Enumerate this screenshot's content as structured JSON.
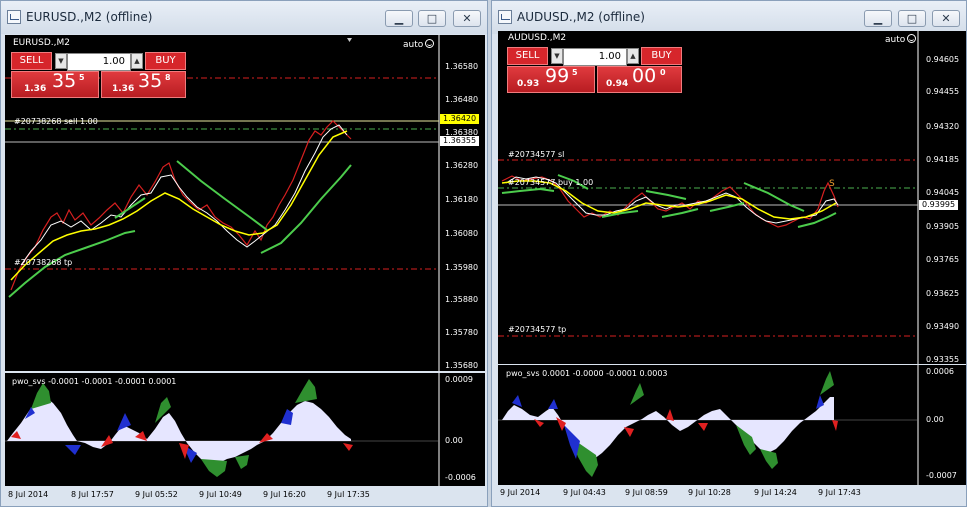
{
  "colors": {
    "ask_box": "#ffff00",
    "bid_box": "#ffffff",
    "line_red": "#d62020",
    "sl_label": "#f0a030"
  },
  "windows": [
    {
      "title": "EURUSD.,M2 (offline)",
      "symbol_label": "EURUSD.,M2",
      "auto_label": "auto",
      "panel": {
        "sell": "SELL",
        "buy": "BUY",
        "lot": "1.00",
        "sell_price": {
          "small": "1.36",
          "big": "35",
          "sup": "5"
        },
        "buy_price": {
          "small": "1.36",
          "big": "35",
          "sup": "8"
        }
      },
      "price_axis": [
        "1.36580",
        "1.36480",
        "1.36380",
        "1.36280",
        "1.36180",
        "1.36080",
        "1.35980",
        "1.35880",
        "1.35780",
        "1.35680"
      ],
      "ask_price": "1.36420",
      "bid_price": "1.36355",
      "order_labels": [
        "#20738268 sell 1.00",
        "#20738268 tp"
      ],
      "indicator_label": "pwo_svs -0.0001 -0.0001 -0.0001 0.0001",
      "indicator_axis": [
        "0.0009",
        "0.00",
        "-0.0006"
      ],
      "time_axis": [
        "8 Jul 2014",
        "8 Jul 17:57",
        "9 Jul 05:52",
        "9 Jul 10:49",
        "9 Jul 16:20",
        "9 Jul 17:35"
      ],
      "buttons": {
        "min": "▁",
        "max": "□",
        "close": "✕"
      }
    },
    {
      "title": "AUDUSD.,M2 (offline)",
      "symbol_label": "AUDUSD.,M2",
      "auto_label": "auto",
      "panel": {
        "sell": "SELL",
        "buy": "BUY",
        "lot": "1.00",
        "sell_price": {
          "small": "0.93",
          "big": "99",
          "sup": "5"
        },
        "buy_price": {
          "small": "0.94",
          "big": "00",
          "sup": "0"
        }
      },
      "price_axis": [
        "0.94605",
        "0.94455",
        "0.94320",
        "0.94185",
        "0.94045",
        "0.93905",
        "0.93765",
        "0.93625",
        "0.93490",
        "0.93355"
      ],
      "bid_price": "0.93995",
      "order_labels": [
        "#20734577 sl",
        "#20734577 buy 1.00",
        "#20734577 tp"
      ],
      "sl_marker": "S",
      "indicator_label": "pwo_svs 0.0001 -0.0000 -0.0001 0.0003",
      "indicator_axis": [
        "0.0006",
        "0.00",
        "-0.0007"
      ],
      "time_axis": [
        "9 Jul 2014",
        "9 Jul 04:43",
        "9 Jul 08:59",
        "9 Jul 10:28",
        "9 Jul 14:24",
        "9 Jul 17:43"
      ],
      "buttons": {
        "min": "▁",
        "max": "□",
        "close": "✕"
      }
    }
  ]
}
